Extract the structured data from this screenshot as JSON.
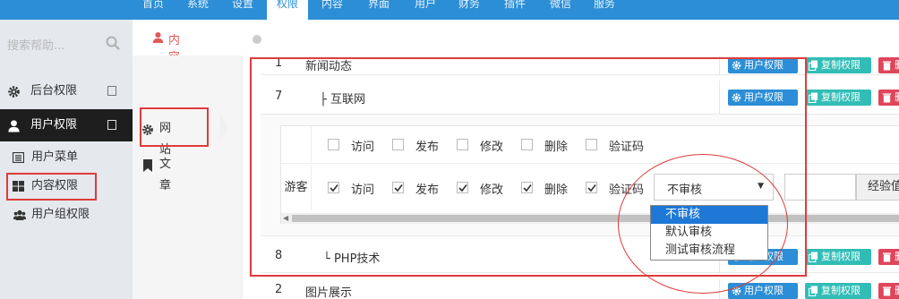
{
  "topnav": {
    "items": [
      {
        "label": "首页",
        "active": false
      },
      {
        "label": "系统",
        "active": false
      },
      {
        "label": "设置",
        "active": false
      },
      {
        "label": "权限",
        "active": true
      },
      {
        "label": "内容",
        "active": false
      },
      {
        "label": "界面",
        "active": false
      },
      {
        "label": "用户",
        "active": false
      },
      {
        "label": "财务",
        "active": false
      },
      {
        "label": "插件",
        "active": false
      },
      {
        "label": "微信",
        "active": false
      },
      {
        "label": "服务",
        "active": false
      }
    ]
  },
  "sidebar": {
    "search_placeholder": "搜索帮助...",
    "items": [
      {
        "label": "后台权限",
        "icon": "gear-icon"
      },
      {
        "label": "用户权限",
        "icon": "user-icon",
        "active": true
      }
    ],
    "subitems": [
      {
        "label": "用户菜单",
        "icon": "list-icon"
      },
      {
        "label": "内容权限",
        "icon": "grid-icon",
        "highlighted": true
      },
      {
        "label": "用户组权限",
        "icon": "users-icon"
      }
    ]
  },
  "secondary_nav": {
    "items": [
      {
        "label": "网站",
        "icon": "gear-icon",
        "highlighted": true
      },
      {
        "label": "文章",
        "icon": "bookmark-icon"
      }
    ]
  },
  "tab": {
    "label": "内容权限"
  },
  "buttons": {
    "user_perm": "用户权限",
    "copy_perm": "复制权限",
    "third": "删"
  },
  "rows": [
    {
      "num": "1",
      "name": "新闻动态"
    },
    {
      "num": "7",
      "name": "├ 互联网"
    },
    {
      "num": "8",
      "name": "└ PHP技术"
    },
    {
      "num": "2",
      "name": "图片展示"
    }
  ],
  "permission_panel": {
    "header_options": [
      "访问",
      "发布",
      "修改",
      "删除",
      "验证码"
    ],
    "guest_label": "游客",
    "guest_options": [
      "访问",
      "发布",
      "修改",
      "删除",
      "验证码"
    ],
    "guest_checked": [
      true,
      true,
      true,
      true,
      true
    ],
    "review_select_value": "不审核",
    "exp_addon_label": "经验值"
  },
  "dropdown": {
    "options": [
      "不审核",
      "默认审核",
      "测试审核流程"
    ],
    "selected_index": 0
  },
  "colors": {
    "primary": "#2b8ed6",
    "teal": "#31bdb6",
    "danger": "#e0455a",
    "annotation_red": "#e03b3b",
    "sidebar_bg": "#e5e8ed",
    "sidebar_active_bg": "#1e1e1e"
  }
}
